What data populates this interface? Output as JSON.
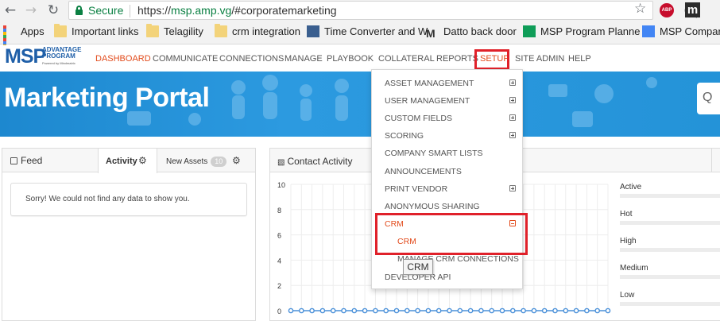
{
  "browser": {
    "secure_label": "Secure",
    "url_prefix": "https://",
    "url_host": "msp.amp.vg",
    "url_path": "/#corporatemarketing",
    "extensions": [
      "ABP",
      "m"
    ],
    "bookmarks": [
      {
        "label": "Apps",
        "icon": "apps-grid-icon"
      },
      {
        "label": "Important links",
        "icon": "folder-icon"
      },
      {
        "label": "Telagility",
        "icon": "folder-icon"
      },
      {
        "label": "crm integration",
        "icon": "folder-icon"
      },
      {
        "label": "Time Converter and W",
        "icon": "time-converter-icon"
      },
      {
        "label": "Datto back door",
        "icon": "datto-icon"
      },
      {
        "label": "MSP Program Planne",
        "icon": "sheets-icon"
      },
      {
        "label": "MSP Compar",
        "icon": "docs-icon"
      }
    ]
  },
  "logo": {
    "text": "MSP",
    "sub_line1": "ADVANTAGE",
    "sub_line2": "PROGRAM",
    "powered": "Powered by Mindmatrix"
  },
  "nav": {
    "items": [
      "DASHBOARD",
      "COMMUNICATE",
      "CONNECTIONS",
      "MANAGE",
      "PLAYBOOK",
      "COLLATERAL",
      "REPORTS",
      "SETUP",
      "SITE ADMIN",
      "HELP"
    ],
    "active": "DASHBOARD"
  },
  "banner": {
    "title": "Marketing Portal",
    "search_glyph": "Q"
  },
  "feed": {
    "title": "Feed",
    "tab_activity": "Activity",
    "tab_new_assets": "New Assets",
    "new_assets_count": "10",
    "empty_message": "Sorry! We could not find any data to show you."
  },
  "contact": {
    "title": "Contact Activity",
    "legend": [
      "Active",
      "Hot",
      "High",
      "Medium",
      "Low"
    ]
  },
  "chart_data": {
    "type": "line",
    "y_ticks": [
      "10",
      "8",
      "6",
      "4",
      "2",
      "0"
    ],
    "ylim": [
      0,
      10
    ],
    "grid": true,
    "series": [
      {
        "values": [
          0,
          0,
          0,
          0,
          0,
          0,
          0,
          0,
          0,
          0,
          0,
          0,
          0,
          0,
          0,
          0,
          0,
          0,
          0,
          0,
          0,
          0,
          0,
          0,
          0,
          0,
          0,
          0,
          0,
          0,
          0
        ]
      }
    ],
    "line_color": "#4a90d9"
  },
  "setup_menu": {
    "items": [
      {
        "label": "ASSET MANAGEMENT",
        "expander": "plus"
      },
      {
        "label": "USER MANAGEMENT",
        "expander": "plus"
      },
      {
        "label": "CUSTOM FIELDS",
        "expander": "plus"
      },
      {
        "label": "SCORING",
        "expander": "plus"
      },
      {
        "label": "COMPANY SMART LISTS",
        "expander": ""
      },
      {
        "label": "ANNOUNCEMENTS",
        "expander": ""
      },
      {
        "label": "PRINT VENDOR",
        "expander": "plus"
      },
      {
        "label": "ANONYMOUS SHARING",
        "expander": ""
      },
      {
        "label": "CRM",
        "expander": "minus"
      }
    ],
    "sub_items": [
      "CRM",
      "MANAGE CRM CONNECTIONS"
    ],
    "last_item": "DEVELOPER API",
    "tooltip": "CRM"
  },
  "colors": {
    "accent_red": "#e24b1c",
    "highlight_red": "#e0212a",
    "banner_blue": "#2493d8",
    "brand_blue": "#1f5fa8",
    "secure_green": "#0b8043"
  }
}
